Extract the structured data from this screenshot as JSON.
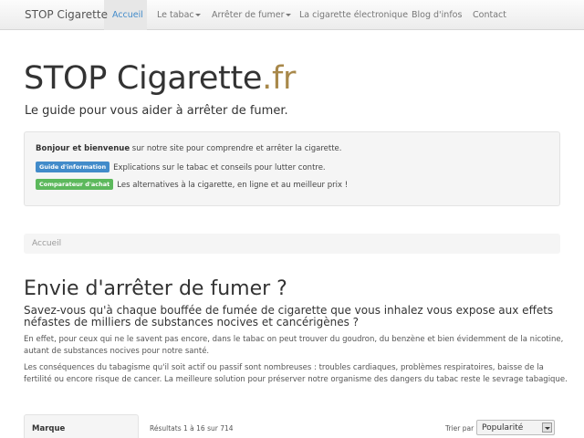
{
  "navbar": {
    "brand": "STOP Cigarette",
    "items": [
      {
        "label": "Accueil",
        "active": true
      },
      {
        "label": "Le tabac",
        "dropdown": true
      },
      {
        "label": "Arrêter de fumer",
        "dropdown": true
      },
      {
        "label": "La cigarette électronique"
      },
      {
        "label": "Blog d'infos"
      },
      {
        "label": "Contact"
      }
    ]
  },
  "header": {
    "title_main": "STOP Cigarette",
    "title_suffix": ".fr",
    "tagline": "Le guide pour vous aider à arrêter de fumer."
  },
  "info_box": {
    "greeting_bold": "Bonjour et bienvenue",
    "greeting_rest": " sur notre site pour comprendre et arrêter la cigarette.",
    "guide_label": "Guide d'information",
    "guide_text": "Explications sur le tabac et conseils pour lutter contre.",
    "comparator_label": "Comparateur d'achat",
    "comparator_text": "Les alternatives à la cigarette, en ligne et au meilleur prix !"
  },
  "breadcrumb": {
    "current": "Accueil"
  },
  "article": {
    "heading": "Envie d'arrêter de fumer ?",
    "lead": "Savez-vous qu'à chaque bouffée de fumée de cigarette que vous inhalez vous expose aux effets néfastes de milliers de substances nocives et cancérigènes ?",
    "para1": "En effet, pour ceux qui ne le savent pas encore, dans le tabac on peut trouver du goudron, du benzène et bien évidemment de la nicotine, autant de substances nocives pour notre santé.",
    "para2": "Les conséquences du tabagisme qu'il soit actif ou passif sont nombreuses : troubles cardiaques, problèmes respiratoires, baisse de la fertilité ou encore risque de cancer. La meilleure solution pour préserver notre organisme des dangers du tabac reste le sevrage tabagique."
  },
  "listing": {
    "sidebar_heading": "Marque",
    "results_text": "Résultats 1 à 16 sur 714",
    "sort_label": "Trier par :",
    "sort_value": "Popularité"
  }
}
